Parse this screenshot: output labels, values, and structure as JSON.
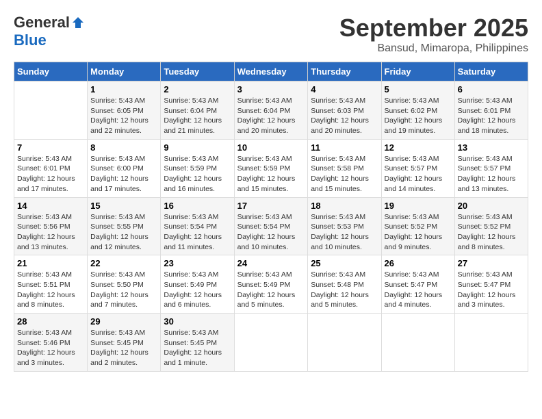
{
  "header": {
    "logo_general": "General",
    "logo_blue": "Blue",
    "month_title": "September 2025",
    "location": "Bansud, Mimaropa, Philippines"
  },
  "days_of_week": [
    "Sunday",
    "Monday",
    "Tuesday",
    "Wednesday",
    "Thursday",
    "Friday",
    "Saturday"
  ],
  "weeks": [
    [
      {
        "day": "",
        "info": ""
      },
      {
        "day": "1",
        "info": "Sunrise: 5:43 AM\nSunset: 6:05 PM\nDaylight: 12 hours\nand 22 minutes."
      },
      {
        "day": "2",
        "info": "Sunrise: 5:43 AM\nSunset: 6:04 PM\nDaylight: 12 hours\nand 21 minutes."
      },
      {
        "day": "3",
        "info": "Sunrise: 5:43 AM\nSunset: 6:04 PM\nDaylight: 12 hours\nand 20 minutes."
      },
      {
        "day": "4",
        "info": "Sunrise: 5:43 AM\nSunset: 6:03 PM\nDaylight: 12 hours\nand 20 minutes."
      },
      {
        "day": "5",
        "info": "Sunrise: 5:43 AM\nSunset: 6:02 PM\nDaylight: 12 hours\nand 19 minutes."
      },
      {
        "day": "6",
        "info": "Sunrise: 5:43 AM\nSunset: 6:01 PM\nDaylight: 12 hours\nand 18 minutes."
      }
    ],
    [
      {
        "day": "7",
        "info": "Sunrise: 5:43 AM\nSunset: 6:01 PM\nDaylight: 12 hours\nand 17 minutes."
      },
      {
        "day": "8",
        "info": "Sunrise: 5:43 AM\nSunset: 6:00 PM\nDaylight: 12 hours\nand 17 minutes."
      },
      {
        "day": "9",
        "info": "Sunrise: 5:43 AM\nSunset: 5:59 PM\nDaylight: 12 hours\nand 16 minutes."
      },
      {
        "day": "10",
        "info": "Sunrise: 5:43 AM\nSunset: 5:59 PM\nDaylight: 12 hours\nand 15 minutes."
      },
      {
        "day": "11",
        "info": "Sunrise: 5:43 AM\nSunset: 5:58 PM\nDaylight: 12 hours\nand 15 minutes."
      },
      {
        "day": "12",
        "info": "Sunrise: 5:43 AM\nSunset: 5:57 PM\nDaylight: 12 hours\nand 14 minutes."
      },
      {
        "day": "13",
        "info": "Sunrise: 5:43 AM\nSunset: 5:57 PM\nDaylight: 12 hours\nand 13 minutes."
      }
    ],
    [
      {
        "day": "14",
        "info": "Sunrise: 5:43 AM\nSunset: 5:56 PM\nDaylight: 12 hours\nand 13 minutes."
      },
      {
        "day": "15",
        "info": "Sunrise: 5:43 AM\nSunset: 5:55 PM\nDaylight: 12 hours\nand 12 minutes."
      },
      {
        "day": "16",
        "info": "Sunrise: 5:43 AM\nSunset: 5:54 PM\nDaylight: 12 hours\nand 11 minutes."
      },
      {
        "day": "17",
        "info": "Sunrise: 5:43 AM\nSunset: 5:54 PM\nDaylight: 12 hours\nand 10 minutes."
      },
      {
        "day": "18",
        "info": "Sunrise: 5:43 AM\nSunset: 5:53 PM\nDaylight: 12 hours\nand 10 minutes."
      },
      {
        "day": "19",
        "info": "Sunrise: 5:43 AM\nSunset: 5:52 PM\nDaylight: 12 hours\nand 9 minutes."
      },
      {
        "day": "20",
        "info": "Sunrise: 5:43 AM\nSunset: 5:52 PM\nDaylight: 12 hours\nand 8 minutes."
      }
    ],
    [
      {
        "day": "21",
        "info": "Sunrise: 5:43 AM\nSunset: 5:51 PM\nDaylight: 12 hours\nand 8 minutes."
      },
      {
        "day": "22",
        "info": "Sunrise: 5:43 AM\nSunset: 5:50 PM\nDaylight: 12 hours\nand 7 minutes."
      },
      {
        "day": "23",
        "info": "Sunrise: 5:43 AM\nSunset: 5:49 PM\nDaylight: 12 hours\nand 6 minutes."
      },
      {
        "day": "24",
        "info": "Sunrise: 5:43 AM\nSunset: 5:49 PM\nDaylight: 12 hours\nand 5 minutes."
      },
      {
        "day": "25",
        "info": "Sunrise: 5:43 AM\nSunset: 5:48 PM\nDaylight: 12 hours\nand 5 minutes."
      },
      {
        "day": "26",
        "info": "Sunrise: 5:43 AM\nSunset: 5:47 PM\nDaylight: 12 hours\nand 4 minutes."
      },
      {
        "day": "27",
        "info": "Sunrise: 5:43 AM\nSunset: 5:47 PM\nDaylight: 12 hours\nand 3 minutes."
      }
    ],
    [
      {
        "day": "28",
        "info": "Sunrise: 5:43 AM\nSunset: 5:46 PM\nDaylight: 12 hours\nand 3 minutes."
      },
      {
        "day": "29",
        "info": "Sunrise: 5:43 AM\nSunset: 5:45 PM\nDaylight: 12 hours\nand 2 minutes."
      },
      {
        "day": "30",
        "info": "Sunrise: 5:43 AM\nSunset: 5:45 PM\nDaylight: 12 hours\nand 1 minute."
      },
      {
        "day": "",
        "info": ""
      },
      {
        "day": "",
        "info": ""
      },
      {
        "day": "",
        "info": ""
      },
      {
        "day": "",
        "info": ""
      }
    ]
  ]
}
